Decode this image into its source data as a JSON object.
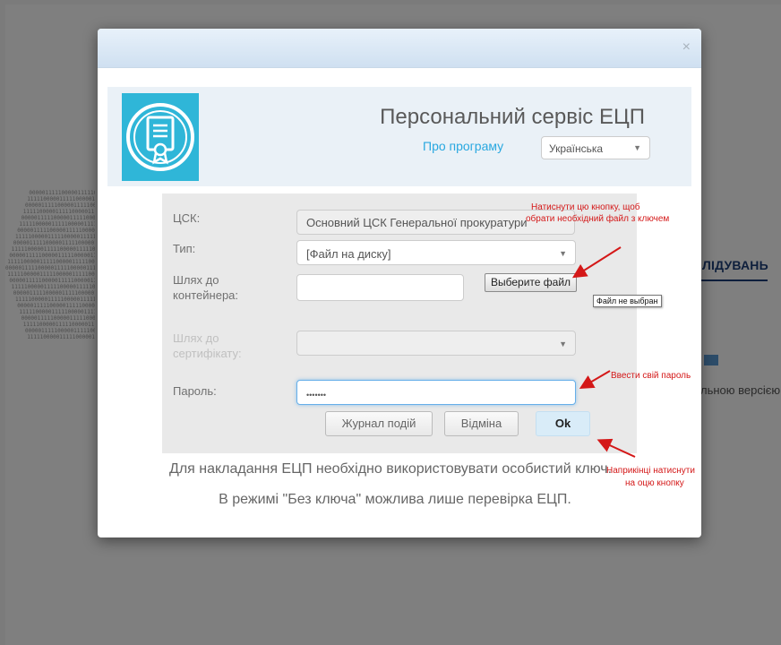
{
  "background": {
    "heading": "ЛІДУВАНЬ",
    "text": "льною версією"
  },
  "modal": {
    "close_label": "×",
    "banner": {
      "title": "Персональний сервіс ЕЦП",
      "about_link": "Про програму",
      "language": "Українська"
    },
    "form": {
      "csk_label": "ЦСК:",
      "csk_value": "Основний ЦСК Генеральної прокуратури",
      "type_label": "Тип:",
      "type_value": "[Файл на диску]",
      "container_label_1": "Шлях до",
      "container_label_2": "контейнера:",
      "container_value": "",
      "file_button": "Выберите файл",
      "cert_label_1": "Шлях до",
      "cert_label_2": "сертифікату:",
      "cert_value": "",
      "password_label": "Пароль:",
      "password_value": "•••••••",
      "journal_button": "Журнал подій",
      "cancel_button": "Відміна",
      "ok_button": "Ok"
    },
    "info_line_1": "Для накладання ЕЦП необхідно використовувати особистий ключ.",
    "info_line_2": "В режимі \"Без ключа\" можлива лише перевірка ЕЦП."
  },
  "tooltip": "Файл не выбран",
  "annotations": {
    "note_file_1": "Натиснути цю кнопку, щоб",
    "note_file_2": "обрати необхідний файл з ключем",
    "note_password": "Ввести свій пароль",
    "note_ok_1": "Наприкінці натиснути",
    "note_ok_2": "на оцю кнопку"
  },
  "colors": {
    "annotation": "#d41818",
    "accent": "#29a8e0",
    "logo_teal": "#2fb6d8"
  }
}
